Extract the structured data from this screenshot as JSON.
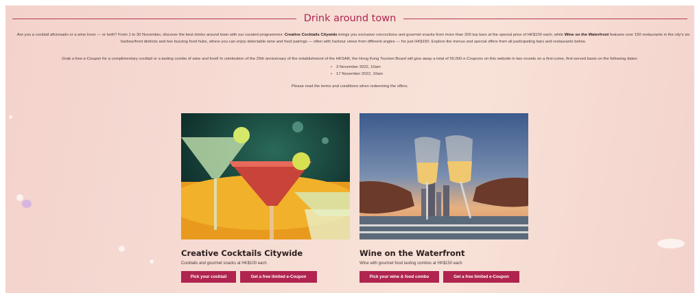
{
  "section": {
    "title": "Drink around town"
  },
  "intro": {
    "part1": "Are you a cocktail aficionado or a wine lover — or both? From 1 to 30 November, discover the best drinks around town with our curated programmes: ",
    "cocktails_bold": "Creative Cocktails Citywide",
    "part2": " brings you exclusive concoctions and gourmet snacks from more than 200 top bars at the special price of HK$100 each; while ",
    "wine_bold": "Wine on the Waterfront",
    "part3": " features over 150 restaurants in the city's six harbourfront districts and two buzzing food hubs, where you can enjoy delectable wine and food pairings — often with harbour views from different angles — for just HK$150. Explore the menus and special offers from all participating bars and restaurants below."
  },
  "coupon": {
    "text": "Grab a free e-Coupon for a complimentary cocktail or a tasting combo of wine and food! In celebration of the 25th anniversary of the establishment of the HKSAR, the Hong Kong Tourism Board will give away a total of 50,000 e-Coupons on this website in two rounds on a first-come, first-served basis on the following dates:",
    "dates": [
      "3 November 2022, 10am",
      "17 November 2022, 10am"
    ],
    "terms": "Please read the terms and conditions when redeeming the offers."
  },
  "cards": [
    {
      "title": "Creative Cocktails Citywide",
      "desc": "Cocktails and gourmet snacks at HK$100 each",
      "btn1": "Pick your cocktail",
      "btn2": "Get a free limited e-Coupon"
    },
    {
      "title": "Wine on the Waterfront",
      "desc": "Wine with gourmet food tasting combos at HK$150 each",
      "btn1": "Pick your wine & food combo",
      "btn2": "Get a free limited e-Coupon"
    }
  ],
  "colors": {
    "accent": "#b0244f",
    "background": "#f6dcd4"
  }
}
